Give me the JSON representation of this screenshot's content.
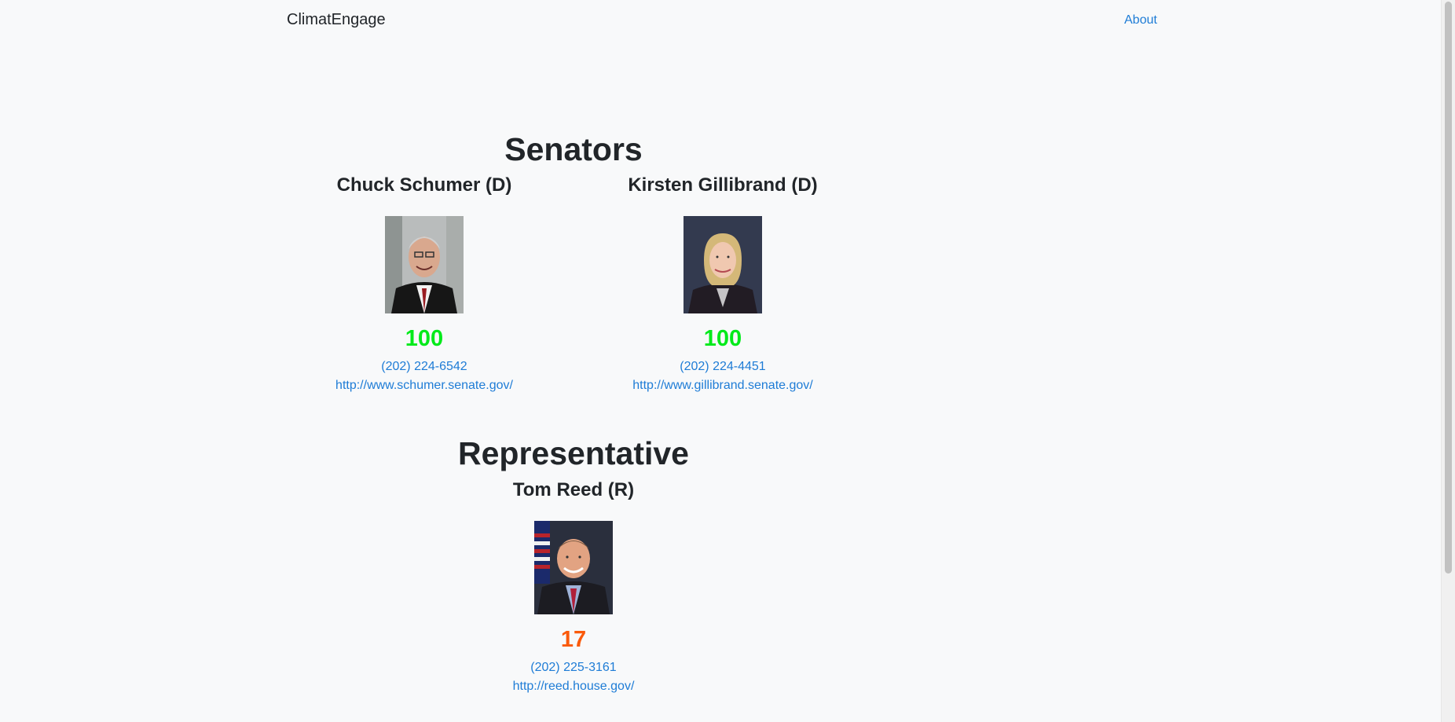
{
  "nav": {
    "brand": "ClimatEngage",
    "about": "About"
  },
  "senators": {
    "title": "Senators",
    "members": [
      {
        "name": "Chuck Schumer (D)",
        "score": "100",
        "phone": "(202) 224-6542",
        "url": "http://www.schumer.senate.gov/"
      },
      {
        "name": "Kirsten Gillibrand (D)",
        "score": "100",
        "phone": "(202) 224-4451",
        "url": "http://www.gillibrand.senate.gov/"
      }
    ]
  },
  "representative": {
    "title": "Representative",
    "members": [
      {
        "name": "Tom Reed (R)",
        "score": "17",
        "phone": "(202) 225-3161",
        "url": "http://reed.house.gov/"
      }
    ]
  },
  "colors": {
    "link": "#1e7cd6",
    "score_high": "#00ea1a",
    "score_low": "#fa5a0b",
    "background": "#f8f9fa"
  }
}
